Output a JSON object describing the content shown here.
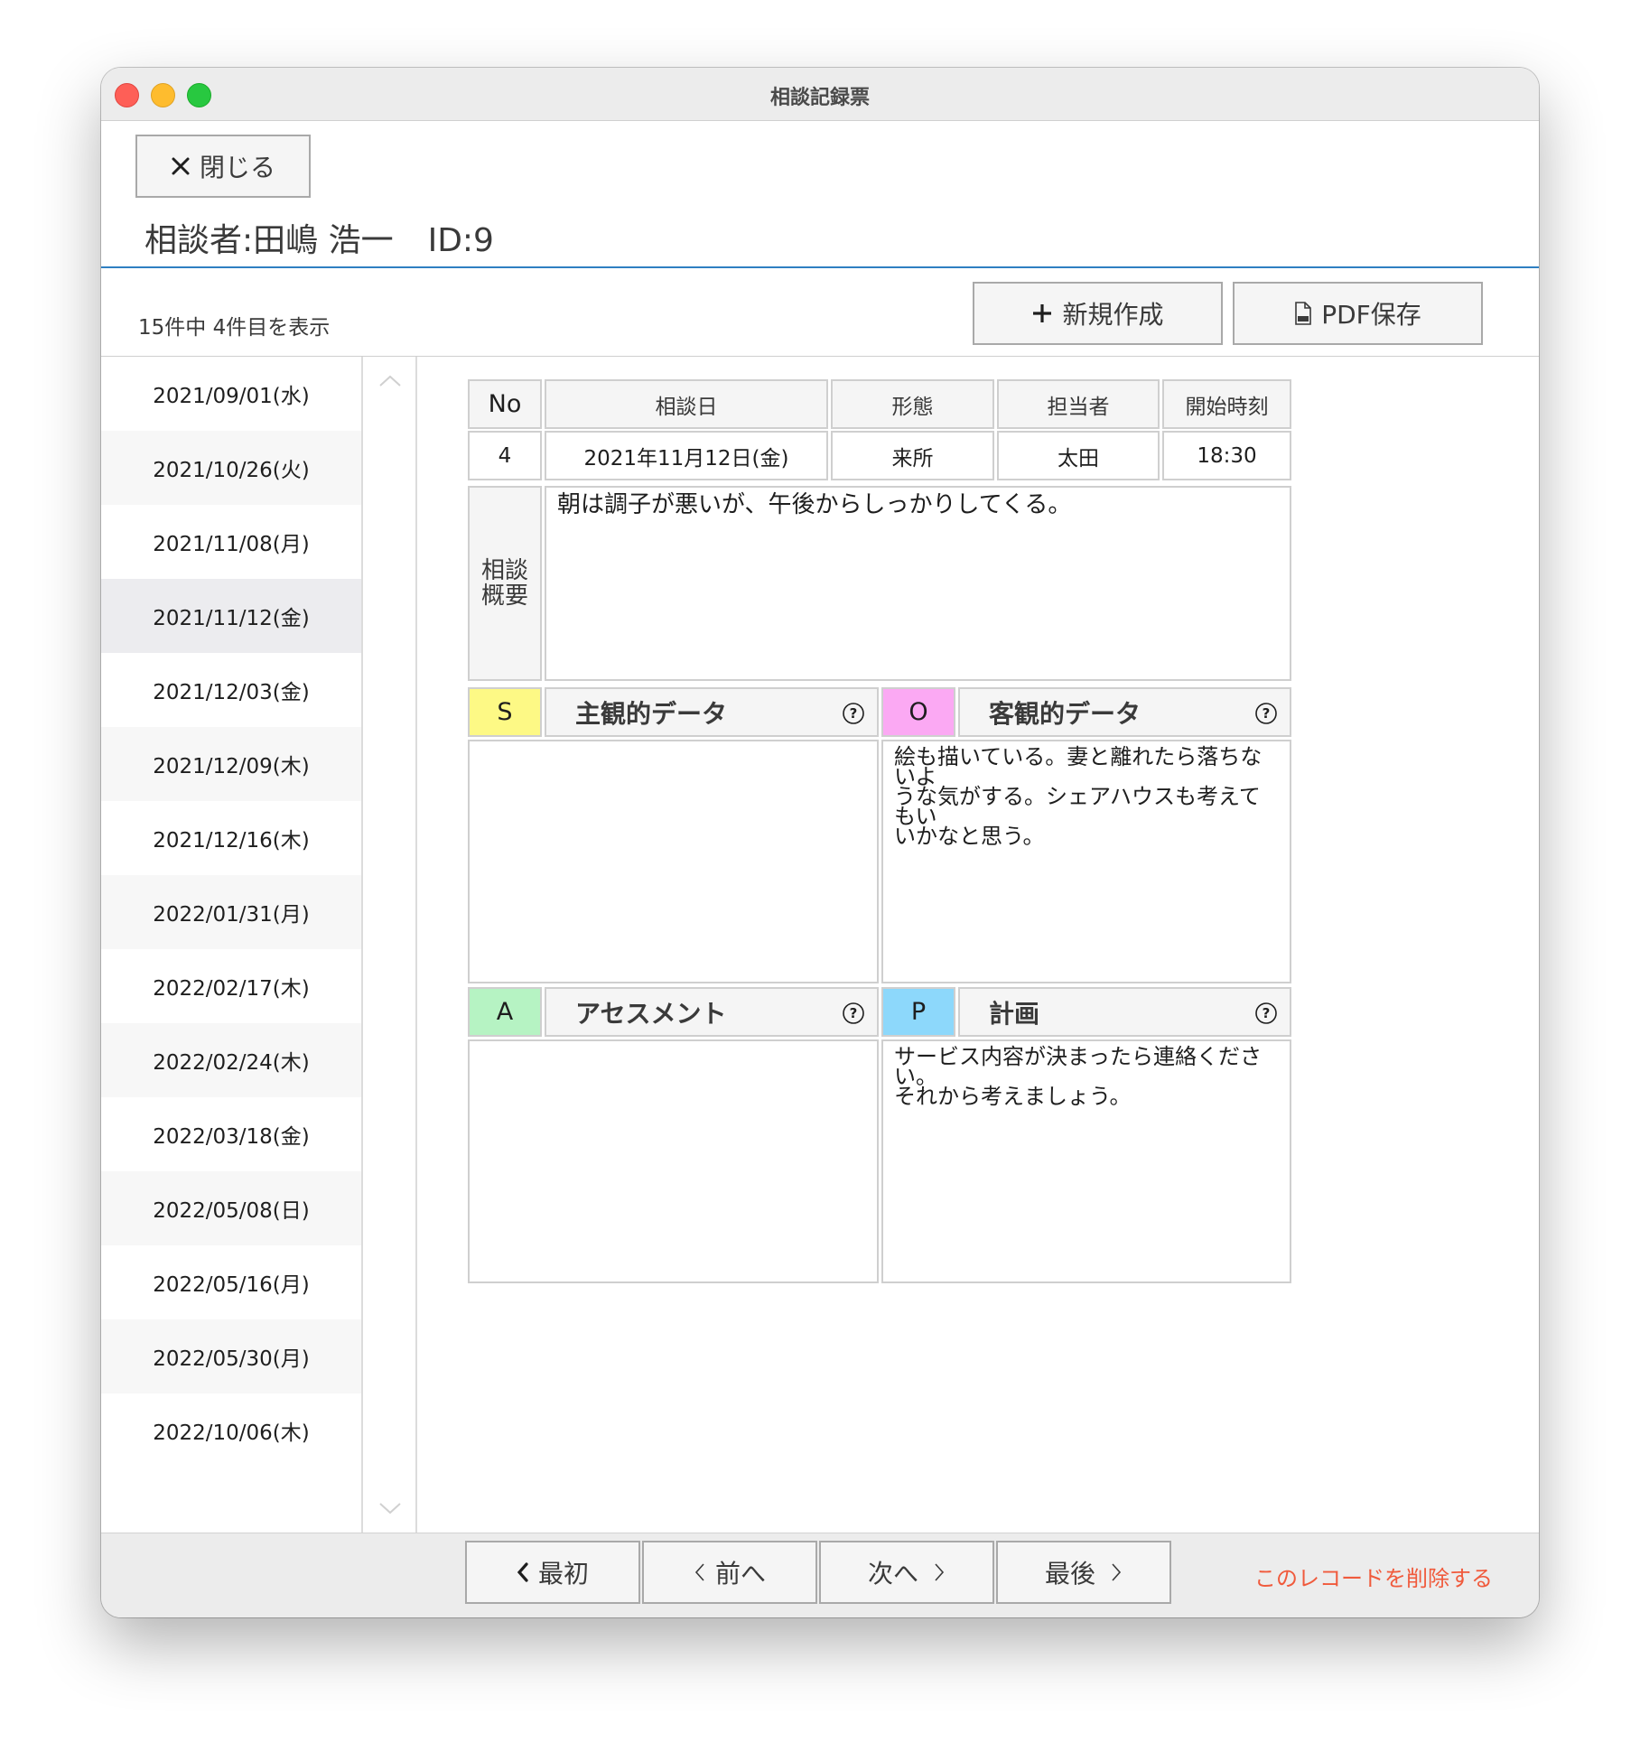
{
  "window": {
    "title": "相談記録票"
  },
  "toolbar": {
    "close_label": "閉じる",
    "new_label": "新規作成",
    "pdf_label": "PDF保存"
  },
  "client": {
    "label": "相談者:田嶋 浩一",
    "id": "ID:9"
  },
  "record_count": "15件中 4件目を表示",
  "dates": [
    "2021/09/01(水)",
    "2021/10/26(火)",
    "2021/11/08(月)",
    "2021/11/12(金)",
    "2021/12/03(金)",
    "2021/12/09(木)",
    "2021/12/16(木)",
    "2022/01/31(月)",
    "2022/02/17(木)",
    "2022/02/24(木)",
    "2022/03/18(金)",
    "2022/05/08(日)",
    "2022/05/16(月)",
    "2022/05/30(月)",
    "2022/10/06(木)"
  ],
  "record": {
    "headers": {
      "no": "No",
      "date": "相談日",
      "type": "形態",
      "staff": "担当者",
      "start": "開始時刻"
    },
    "values": {
      "no": "4",
      "date": "2021年11月12日(金)",
      "type": "来所",
      "staff": "太田",
      "start": "18:30"
    },
    "summary_label": "相談\n概要",
    "summary": "朝は調子が悪いが、午後からしっかりしてくる。"
  },
  "soap": {
    "s": {
      "letter": "S",
      "title": "主観的データ",
      "text": "",
      "color": "#fdf985"
    },
    "o": {
      "letter": "O",
      "title": "客観的データ",
      "text": "絵も描いている。妻と離れたら落ちないよ\nうな気がする。シェアハウスも考えてもい\nいかなと思う。",
      "color": "#fba9f3"
    },
    "a": {
      "letter": "A",
      "title": "アセスメント",
      "text": "",
      "color": "#b6f3c3"
    },
    "p": {
      "letter": "P",
      "title": "計画",
      "text": "サービス内容が決まったら連絡ください。\nそれから考えましょう。",
      "color": "#8dd8fb"
    }
  },
  "nav": {
    "first": "最初",
    "prev": "前へ",
    "next": "次へ",
    "last": "最後",
    "delete": "このレコードを削除する"
  }
}
